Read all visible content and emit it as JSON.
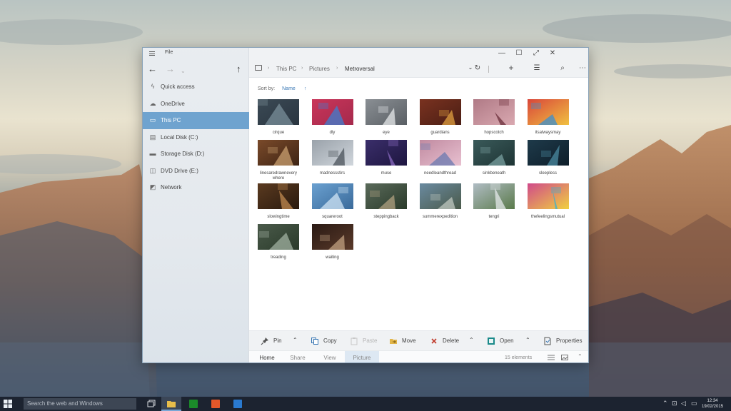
{
  "window": {
    "menu_label": "File",
    "title_controls": [
      "—",
      "☐",
      "⤢",
      "✕"
    ]
  },
  "nav": {
    "items": [
      {
        "label": "Quick access",
        "icon": "lightning-icon",
        "glyph": "ϟ",
        "selected": false
      },
      {
        "label": "OneDrive",
        "icon": "cloud-icon",
        "glyph": "☁",
        "selected": false
      },
      {
        "label": "This PC",
        "icon": "computer-icon",
        "glyph": "▭",
        "selected": true
      },
      {
        "label": "Local Disk (C:)",
        "icon": "disk-icon",
        "glyph": "▤",
        "selected": false
      },
      {
        "label": "Storage Disk (D:)",
        "icon": "disk-icon",
        "glyph": "▬",
        "selected": false
      },
      {
        "label": "DVD Drive (E:)",
        "icon": "dvd-icon",
        "glyph": "◫",
        "selected": false
      },
      {
        "label": "Network",
        "icon": "network-icon",
        "glyph": "◩",
        "selected": false
      }
    ]
  },
  "address": {
    "breadcrumb": [
      "This PC",
      "Pictures",
      "Metroversal"
    ]
  },
  "sort": {
    "label": "Sort by:",
    "value": "Name",
    "direction": "↑"
  },
  "files": [
    {
      "name": "cirque",
      "colors": [
        "#3b4a55",
        "#7a8f99",
        "#2a3540"
      ]
    },
    {
      "name": "dly",
      "colors": [
        "#c9355a",
        "#3e7fd0",
        "#a52a4c"
      ]
    },
    {
      "name": "eye",
      "colors": [
        "#8a8f94",
        "#e6e8ea",
        "#5a5f64"
      ]
    },
    {
      "name": "guardians",
      "colors": [
        "#7a3220",
        "#e0a040",
        "#4a1e14"
      ]
    },
    {
      "name": "hopscotch",
      "colors": [
        "#b07a86",
        "#6a2e3a",
        "#d9a8b0"
      ]
    },
    {
      "name": "itsalwaysmay",
      "colors": [
        "#d9463a",
        "#3a8fd0",
        "#f0c040"
      ]
    },
    {
      "name": "linesaredrawnevery where",
      "colors": [
        "#7a4a2a",
        "#c9a070",
        "#3e2414"
      ]
    },
    {
      "name": "madnessstirs",
      "colors": [
        "#9aa2aa",
        "#4a525a",
        "#d0d6dc"
      ]
    },
    {
      "name": "muse",
      "colors": [
        "#3a2e6a",
        "#8a6ac0",
        "#1e1640"
      ]
    },
    {
      "name": "needleandthread",
      "colors": [
        "#c08aa0",
        "#6a7ab0",
        "#e8c0d0"
      ]
    },
    {
      "name": "sinkbeneath",
      "colors": [
        "#3a5a5a",
        "#7aa0a0",
        "#1e3434"
      ]
    },
    {
      "name": "sleepless",
      "colors": [
        "#1e3a4a",
        "#4a8aa0",
        "#0e1e2a"
      ]
    },
    {
      "name": "slowingtime",
      "colors": [
        "#5a3a20",
        "#c08a50",
        "#2a1a0e"
      ]
    },
    {
      "name": "squareroot",
      "colors": [
        "#6aa0d0",
        "#d0e4f4",
        "#3a6a9a"
      ]
    },
    {
      "name": "steppingback",
      "colors": [
        "#5a6a5a",
        "#b0a080",
        "#2a3a2a"
      ]
    },
    {
      "name": "summerexpedition",
      "colors": [
        "#6a8aa0",
        "#c0c8c0",
        "#4a5a4a"
      ]
    },
    {
      "name": "tengri",
      "colors": [
        "#b0bcc4",
        "#e4e8ea",
        "#5a7a4a"
      ]
    },
    {
      "name": "thefeelingsmutual",
      "colors": [
        "#d04a8a",
        "#3ab0d0",
        "#f0d040"
      ]
    },
    {
      "name": "treading",
      "colors": [
        "#4a5a4a",
        "#a0b0a0",
        "#2a3a2a"
      ]
    },
    {
      "name": "waiting",
      "colors": [
        "#2a1a14",
        "#c0a080",
        "#5a3a2a"
      ]
    }
  ],
  "ribbon": {
    "pin": "Pin",
    "copy": "Copy",
    "paste": "Paste",
    "move": "Move",
    "delete": "Delete",
    "open": "Open",
    "properties": "Properties"
  },
  "tabs": [
    {
      "label": "Home",
      "active": true
    },
    {
      "label": "Share",
      "active": false
    },
    {
      "label": "View",
      "active": false
    },
    {
      "label": "Picture",
      "active": false
    }
  ],
  "status": {
    "count": "15 elements"
  },
  "taskbar": {
    "search_placeholder": "Search the web and Windows",
    "time": "12:34",
    "date": "19/02/2015"
  },
  "colors": {
    "accent": "#3a78b5",
    "nav_selected": "#6fa3cf",
    "taskbar": "#1c2330"
  }
}
